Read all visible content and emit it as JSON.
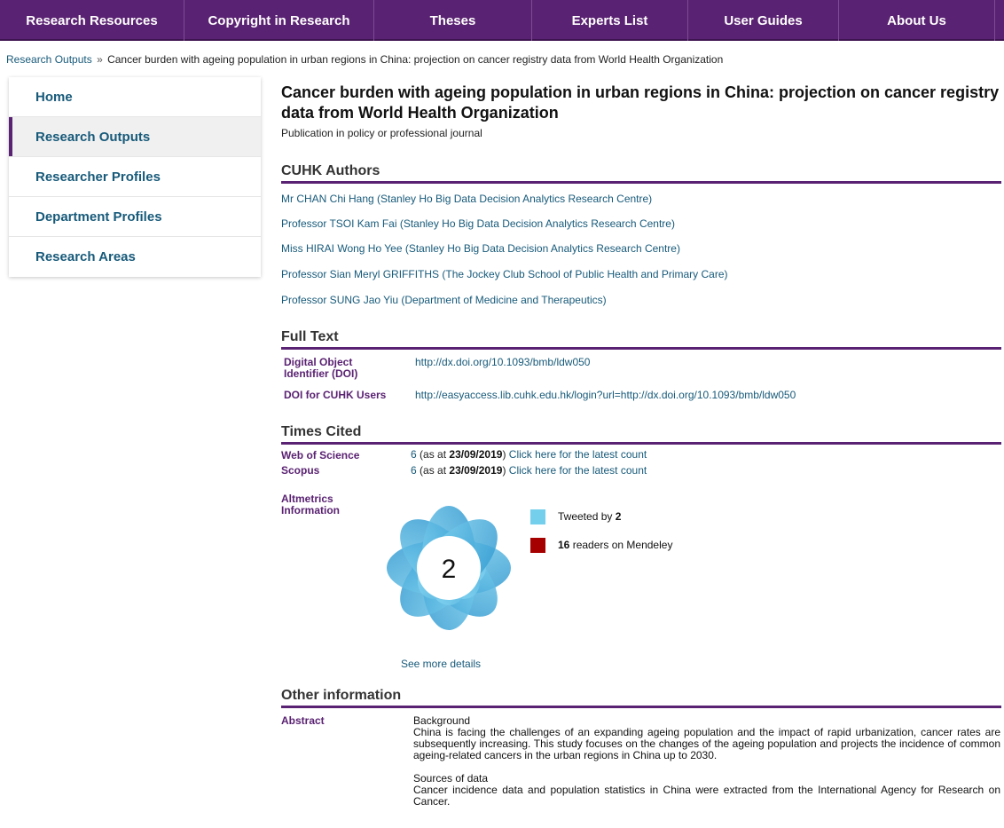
{
  "nav": {
    "items": [
      "Research Resources",
      "Copyright in Research",
      "Theses",
      "Experts List",
      "User Guides",
      "About Us"
    ]
  },
  "breadcrumb": {
    "parent": "Research Outputs",
    "separator": "»",
    "current": "Cancer burden with ageing population in urban regions in China: projection on cancer registry data from World Health Organization"
  },
  "sidebar": {
    "items": [
      "Home",
      "Research Outputs",
      "Researcher Profiles",
      "Department Profiles",
      "Research Areas"
    ],
    "active": "Research Outputs"
  },
  "publication": {
    "title": "Cancer burden with ageing population in urban regions in China: projection on cancer registry data from World Health Organization",
    "type": "Publication in policy or professional journal"
  },
  "authors": {
    "heading": "CUHK Authors",
    "list": [
      "Mr CHAN Chi Hang (Stanley Ho Big Data Decision Analytics Research Centre)",
      "Professor TSOI Kam Fai (Stanley Ho Big Data Decision Analytics Research Centre)",
      "Miss HIRAI Wong Ho Yee (Stanley Ho Big Data Decision Analytics Research Centre)",
      "Professor Sian Meryl GRIFFITHS (The Jockey Club School of Public Health and Primary Care)",
      "Professor SUNG Jao Yiu (Department of Medicine and Therapeutics)"
    ]
  },
  "full_text": {
    "heading": "Full Text",
    "doi_label": "Digital Object Identifier (DOI)",
    "doi_value": "http://dx.doi.org/10.1093/bmb/ldw050",
    "cuhk_label": "DOI for CUHK Users",
    "cuhk_value": "http://easyaccess.lib.cuhk.edu.hk/login?url=http://dx.doi.org/10.1093/bmb/ldw050"
  },
  "times_cited": {
    "heading": "Times Cited",
    "wos_label": "Web of Science",
    "wos_count": "6",
    "wos_as_at": "(as at",
    "wos_date": "23/09/2019",
    "wos_link": "Click here for the latest count",
    "scopus_label": "Scopus",
    "scopus_count": "6",
    "scopus_as_at": "(as at",
    "scopus_date": "23/09/2019",
    "scopus_link": "Click here for the latest count"
  },
  "altmetrics": {
    "label": "Altmetrics Information",
    "score": "2",
    "tweeted_text": "Tweeted by",
    "tweeted_count": "2",
    "mendeley_count": "16",
    "mendeley_text": "readers on Mendeley",
    "more_link": "See more details",
    "colors": {
      "twitter": "#74cfed",
      "mendeley": "#a60000",
      "donut": "#41aee0"
    }
  },
  "other": {
    "heading": "Other information",
    "abstract_label": "Abstract",
    "abstract": [
      {
        "title": "Background",
        "text": "China is facing the challenges of an expanding ageing population and the impact of rapid urbanization, cancer rates are subsequently increasing. This study focuses on the changes of the ageing population and projects the incidence of common ageing-related cancers in the urban regions in China up to 2030."
      },
      {
        "title": "Sources of data",
        "text": "Cancer incidence data and population statistics in China were extracted from the International Agency for Research on Cancer."
      }
    ]
  }
}
